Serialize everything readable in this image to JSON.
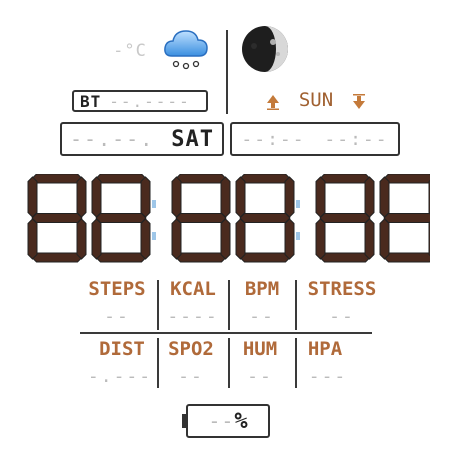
{
  "weather": {
    "temperature": "-°C",
    "icon": "cloud-snow-icon",
    "moon_icon": "moon-phase-icon"
  },
  "bluetooth": {
    "label": "BT",
    "value": "--.----"
  },
  "sun": {
    "label": "SUN",
    "sunrise_icon": "arrow-up-icon",
    "sunset_icon": "arrow-down-icon"
  },
  "date": {
    "digits": "--.--.",
    "day": "SAT"
  },
  "sun_times": {
    "sunrise": "--:--",
    "sunset": "--:--"
  },
  "colors": {
    "accent": "#b06a3a",
    "digit_dim": "#bbbbbb",
    "segment_dark": "#4a2a1e",
    "frame": "#333333"
  },
  "stats": {
    "top": [
      {
        "label": "STEPS",
        "value": "--"
      },
      {
        "label": "KCAL",
        "value": "----"
      },
      {
        "label": "BPM",
        "value": "--"
      },
      {
        "label": "STRESS",
        "value": "--"
      }
    ],
    "bottom": [
      {
        "label": "DIST",
        "value": "-.---"
      },
      {
        "label": "SPO2",
        "value": "--"
      },
      {
        "label": "HUM",
        "value": "--"
      },
      {
        "label": "HPA",
        "value": "---"
      }
    ]
  },
  "battery": {
    "value": "--",
    "unit": "%"
  }
}
